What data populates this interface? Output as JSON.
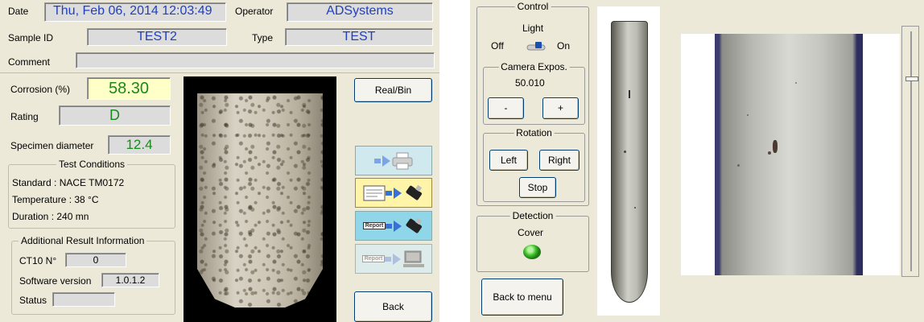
{
  "left": {
    "date_label": "Date",
    "date_value": "Thu, Feb 06, 2014  12:03:49",
    "operator_label": "Operator",
    "operator_value": "ADSystems",
    "sample_id_label": "Sample ID",
    "sample_id_value": "TEST2",
    "type_label": "Type",
    "type_value": "TEST",
    "comment_label": "Comment",
    "comment_value": "",
    "corrosion_label": "Corrosion (%)",
    "corrosion_value": "58.30",
    "rating_label": "Rating",
    "rating_value": "D",
    "diameter_label": "Specimen diameter",
    "diameter_value": "12.4",
    "test_conditions": {
      "title": "Test Conditions",
      "standard": "Standard : NACE TM0172",
      "temperature": "Temperature : 38 °C",
      "duration": "Duration : 240 mn"
    },
    "additional": {
      "title": "Additional Result Information",
      "ct10_label": "CT10 N°",
      "ct10_value": "0",
      "software_label": "Software version",
      "software_value": "1.0.1.2",
      "status_label": "Status",
      "status_value": ""
    },
    "buttons": {
      "realbin": "Real/Bin",
      "report_tag": "Report",
      "back": "Back"
    }
  },
  "right": {
    "control": {
      "title": "Control",
      "light_label": "Light",
      "off_label": "Off",
      "on_label": "On"
    },
    "camera": {
      "title": "Camera Expos.",
      "value": "50.010",
      "minus": "-",
      "plus": "+"
    },
    "rotation": {
      "title": "Rotation",
      "left": "Left",
      "right": "Right",
      "stop": "Stop"
    },
    "detection": {
      "title": "Detection",
      "cover_label": "Cover",
      "indicator_color": "#3fbf2a"
    },
    "back_to_menu": "Back to menu"
  },
  "colors": {
    "panel_bg": "#ece9d8",
    "value_blue": "#1f3fb5",
    "value_green": "#1a8a1a",
    "corrosion_bg": "#ffffc8"
  }
}
